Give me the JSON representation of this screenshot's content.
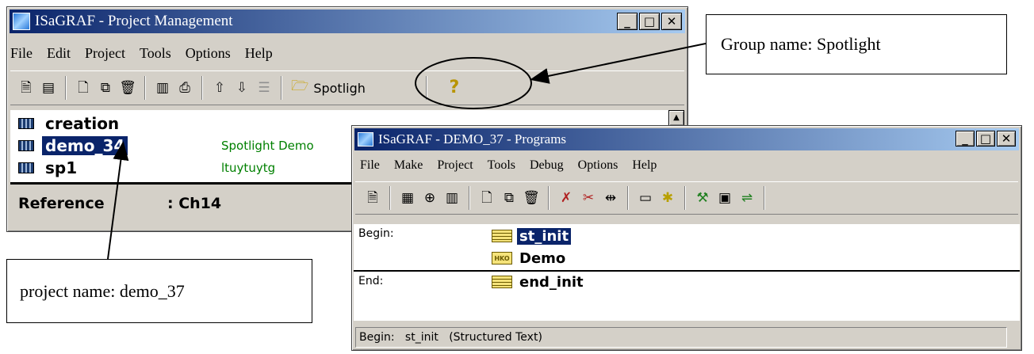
{
  "project_window": {
    "title": "ISaGRAF - Project Management",
    "menu": [
      "File",
      "Edit",
      "Project",
      "Tools",
      "Options",
      "Help"
    ],
    "toolbar_icons": [
      "new-doc-icon",
      "card-icon",
      "blank-page-icon",
      "copy-icon",
      "delete-icon",
      "io-icon",
      "print-icon",
      "up-arrow-icon",
      "down-arrow-icon",
      "list-icon"
    ],
    "group_button_label": "Spotligh",
    "help_icon_glyph": "?",
    "projects": [
      {
        "name": "creation",
        "desc": ""
      },
      {
        "name": "demo_34",
        "desc": "Spotlight Demo"
      },
      {
        "name": "sp1",
        "desc": "ltuytuytg"
      }
    ],
    "reference_label": "Reference",
    "reference_value": ": Ch14"
  },
  "programs_window": {
    "title": "ISaGRAF - DEMO_37 - Programs",
    "menu": [
      "File",
      "Make",
      "Project",
      "Tools",
      "Debug",
      "Options",
      "Help"
    ],
    "sections": {
      "begin": "Begin:",
      "end": "End:"
    },
    "programs": [
      {
        "name": "st_init",
        "section": "begin"
      },
      {
        "name": "Demo",
        "section": "begin"
      },
      {
        "name": "end_init",
        "section": "end"
      }
    ],
    "status": "Begin:   st_init   (Structured Text)"
  },
  "callouts": {
    "group": "Group name: Spotlight",
    "project": "project name: demo_37"
  },
  "colors": {
    "active_title_from": "#0a246a",
    "active_title_to": "#a6caf0",
    "inactive_title_from": "#808080",
    "inactive_title_to": "#c0c0c0",
    "selection": "#0a246a",
    "desc_green": "#008000"
  }
}
